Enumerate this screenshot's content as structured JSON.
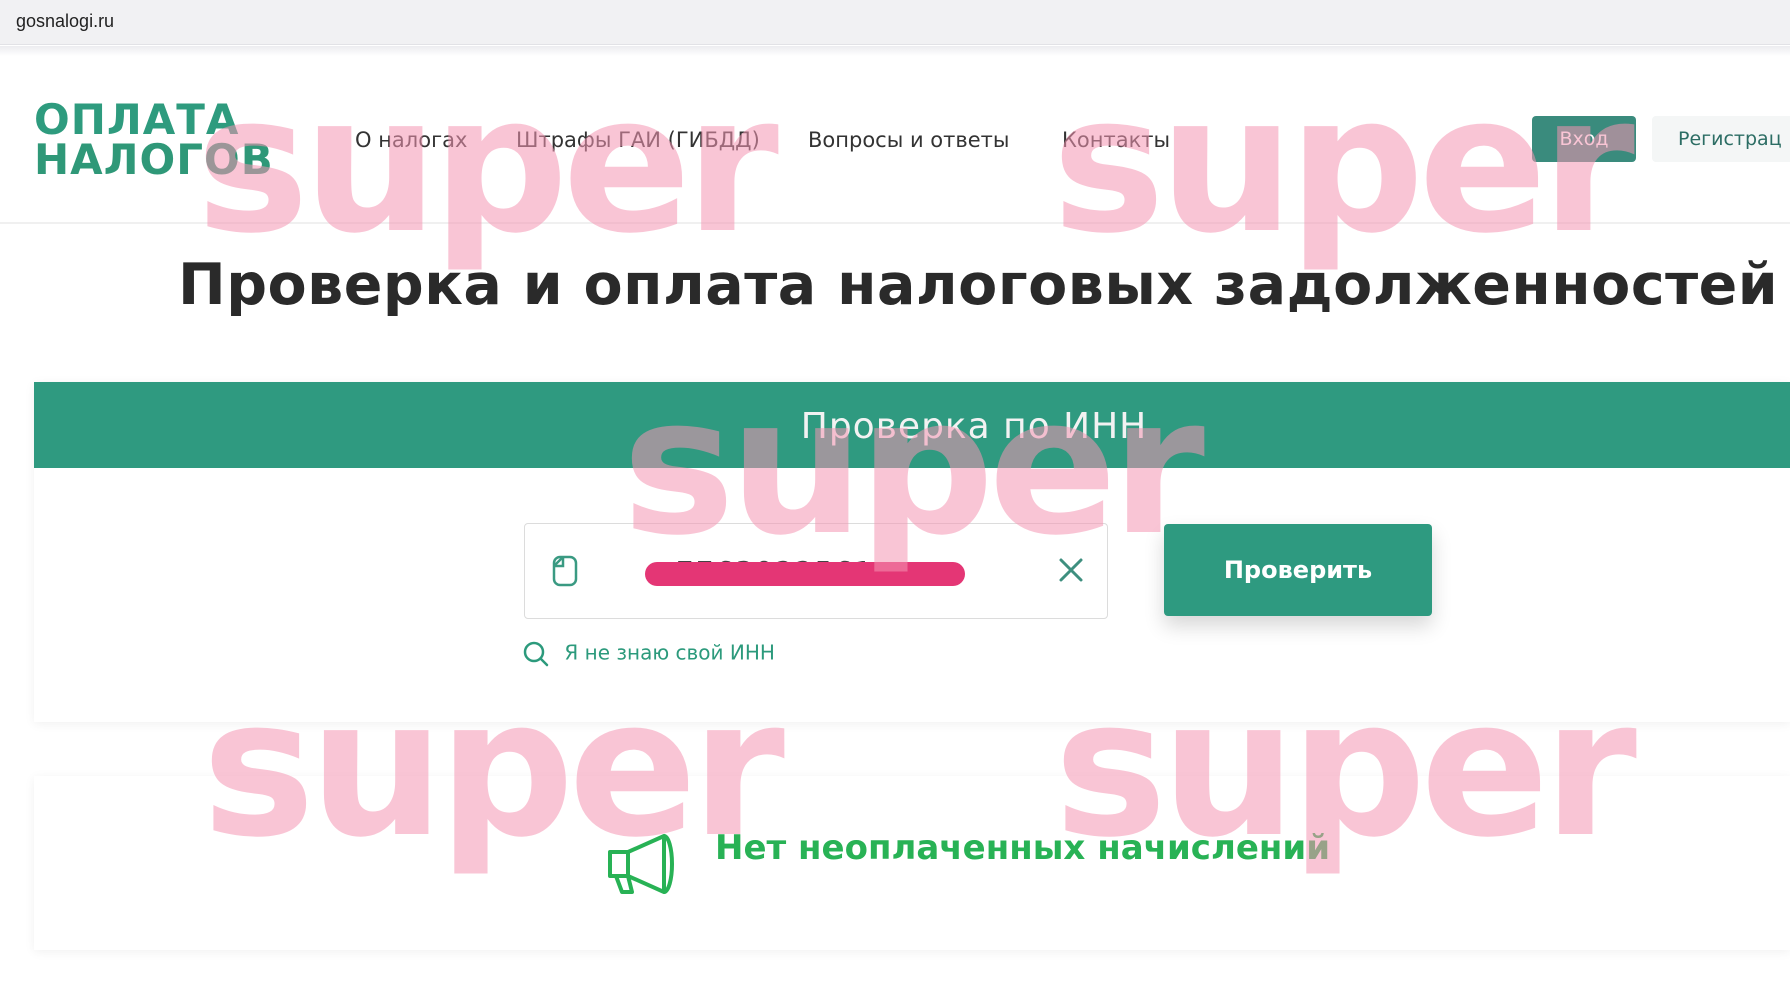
{
  "browser": {
    "url": "gosnalogi.ru"
  },
  "header": {
    "logo_line1": "ОПЛАТА",
    "logo_line2": "НАЛОГОВ",
    "nav": [
      "О налогах",
      "Штрафы ГАИ (ГИБДД)",
      "Вопросы и ответы",
      "Контакты"
    ],
    "login_label": "Вход",
    "register_label": "Регистрац"
  },
  "page_title": "Проверка и оплата налоговых задолженностей",
  "inn_check": {
    "title": "Проверка по ИНН",
    "input_value": "7763022561",
    "submit_label": "Проверить",
    "dont_know_label": "Я не знаю свой ИНН"
  },
  "result": {
    "message": "Нет неоплаченных начислений"
  },
  "watermark": "super",
  "colors": {
    "brand_green": "#2f9a80",
    "login_button": "#3a8b7d",
    "success_text": "#28b255",
    "redaction": "#e43675",
    "watermark": "#f496b2"
  },
  "icons": [
    "document-icon",
    "clear-icon",
    "search-icon",
    "megaphone-icon"
  ]
}
